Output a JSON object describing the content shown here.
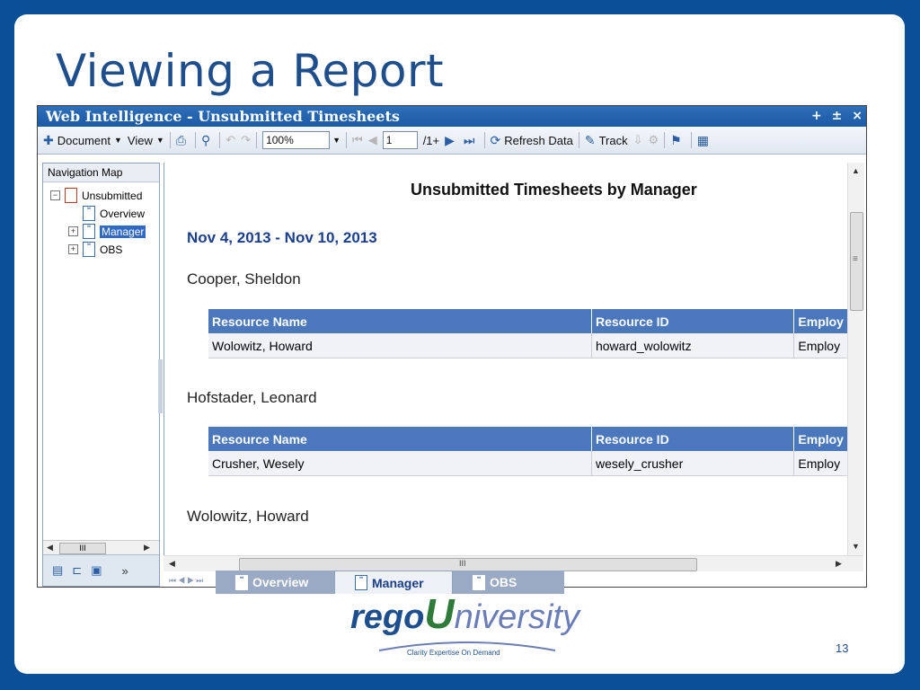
{
  "slide": {
    "title": "Viewing a Report",
    "page_number": "13",
    "logo": {
      "part1": "rego",
      "part2": "U",
      "part3": "niversity",
      "tagline": "Clarity Expertise On Demand"
    }
  },
  "window": {
    "title": "Web Intelligence - Unsubmitted Timesheets",
    "controls": [
      "+",
      "±",
      "×"
    ]
  },
  "toolbar": {
    "document_label": "Document",
    "view_label": "View",
    "zoom": "100%",
    "page_input": "1",
    "page_total": "/1+",
    "refresh_label": "Refresh Data",
    "track_label": "Track"
  },
  "navigation": {
    "header": "Navigation Map",
    "items": [
      {
        "label": "Unsubmitted",
        "expander": "−"
      },
      {
        "label": "Overview"
      },
      {
        "label": "Manager",
        "expander": "+"
      },
      {
        "label": "OBS",
        "expander": "+"
      }
    ],
    "scroll_mark": "III"
  },
  "report": {
    "title": "Unsubmitted Timesheets by Manager",
    "date_range": "Nov 4, 2013 - Nov 10, 2013",
    "columns": [
      "Resource Name",
      "Resource ID",
      "Employ"
    ],
    "groups": [
      {
        "manager": "Cooper, Sheldon",
        "rows": [
          [
            "Wolowitz, Howard",
            "howard_wolowitz",
            "Employ"
          ]
        ]
      },
      {
        "manager": "Hofstader, Leonard",
        "rows": [
          [
            "Crusher, Wesely",
            "wesely_crusher",
            "Employ"
          ]
        ]
      },
      {
        "manager": "Wolowitz, Howard"
      }
    ],
    "scroll_mark": "III"
  },
  "tabs": [
    {
      "label": "Overview",
      "active": false
    },
    {
      "label": "Manager",
      "active": true
    },
    {
      "label": "OBS",
      "active": false
    }
  ]
}
